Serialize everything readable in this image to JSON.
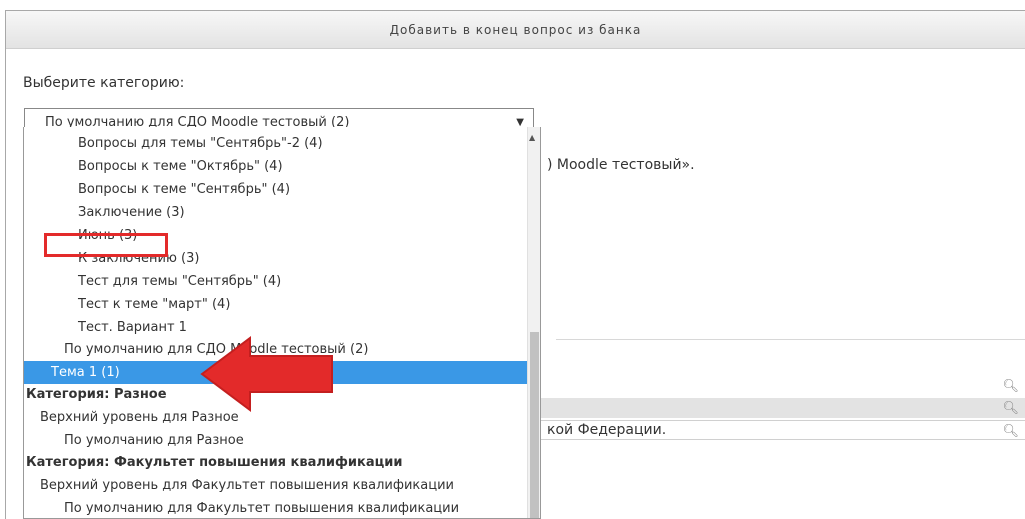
{
  "dialog": {
    "title": "Добавить в конец вопрос из банка",
    "category_label": "Выберите категорию:",
    "selected_category": "По умолчанию для СДО Moodle тестовый (2)"
  },
  "background": {
    "course_text": ") Moodle тестовый».",
    "row_text": "кой Федерации."
  },
  "dropdown": {
    "options": [
      {
        "label": "Вопросы для темы \"Сентябрь\"-2 (4)"
      },
      {
        "label": "Вопросы к теме \"Октябрь\" (4)"
      },
      {
        "label": "Вопросы к теме \"Сентябрь\" (4)"
      },
      {
        "label": "Заключение (3)"
      },
      {
        "label": "Июнь (3)"
      },
      {
        "label": "К заключению (3)"
      },
      {
        "label": "Тест для темы \"Сентябрь\" (4)"
      },
      {
        "label": "Тест к теме \"март\" (4)"
      },
      {
        "label": "Тест. Вариант 1"
      },
      {
        "label": "По умолчанию для СДО Moodle тестовый (2)"
      },
      {
        "label": "Тема 1 (1)"
      },
      {
        "label": "Категория: Разное"
      },
      {
        "label": "Верхний уровень для Разное"
      },
      {
        "label": "По умолчанию для Разное"
      },
      {
        "label": "Категория: Факультет повышения квалификации"
      },
      {
        "label": "Верхний уровень для Факультет повышения квалификации"
      },
      {
        "label": "По умолчанию для Факультет повышения квалификации"
      }
    ]
  },
  "icons": {
    "search": "magnifier-icon",
    "dropdown": "triangle-down-icon"
  },
  "colors": {
    "selection": "#3a98e6",
    "annotation": "#e32a2a"
  }
}
